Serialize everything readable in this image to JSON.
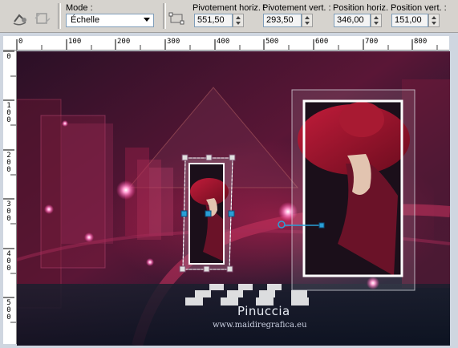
{
  "toolbar": {
    "mode_label": "Mode :",
    "mode_value": "Échelle",
    "pivot_h_label": "Pivotement horiz. :",
    "pivot_h_value": "551,50",
    "pivot_v_label": "Pivotement vert. :",
    "pivot_v_value": "293,50",
    "pos_h_label": "Position horiz. :",
    "pos_h_value": "346,00",
    "pos_v_label": "Position vert. :",
    "pos_v_value": "151,00"
  },
  "ruler": {
    "horizontal_ticks": [
      "0",
      "100",
      "200",
      "300",
      "400",
      "500",
      "600",
      "700",
      "800"
    ],
    "vertical_ticks": [
      "0",
      "100",
      "200",
      "300",
      "400",
      "500"
    ]
  },
  "canvas": {
    "watermark_name": "Pinuccia",
    "watermark_url": "www.maidiregrafica.eu"
  },
  "colors": {
    "accent": "#a3203f",
    "handle": "#2a9fd6",
    "background_dark": "#1a1428"
  }
}
